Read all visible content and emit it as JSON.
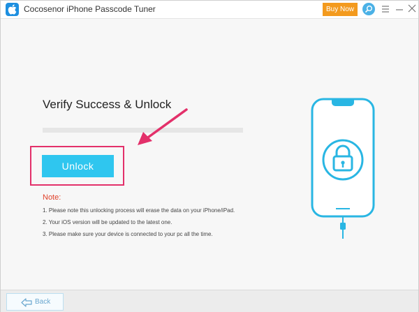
{
  "titlebar": {
    "app_name": "Cocosenor iPhone Passcode Tuner",
    "buy_label": "Buy Now",
    "icons": [
      "apple-logo-icon",
      "search-icon",
      "menu-icon",
      "minimize-icon",
      "close-icon"
    ]
  },
  "main": {
    "title": "Verify Success & Unlock",
    "unlock_label": "Unlock"
  },
  "note": {
    "title": "Note:",
    "items": [
      "1. Please note this unlocking process will erase the data on your iPhone/iPad.",
      "2. Your iOS version will be updated to the latest one.",
      "3. Please make sure your device is connected to your pc all the time."
    ]
  },
  "footer": {
    "back_label": "Back"
  },
  "colors": {
    "accent": "#2fc6ef",
    "buy": "#f39a1e",
    "note": "#e0412a",
    "highlight": "#e3306a",
    "phone": "#29b6e3"
  }
}
